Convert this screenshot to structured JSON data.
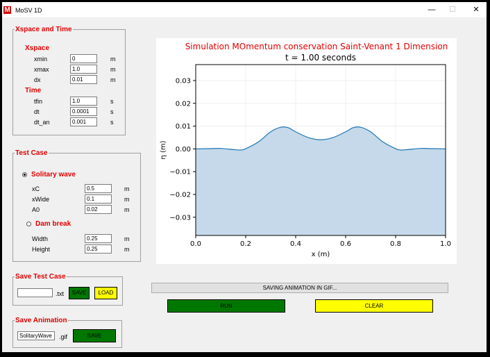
{
  "window": {
    "title": "MoSV 1D",
    "app_icon_letter": "M",
    "minimize_glyph": "—",
    "maximize_glyph": "☐",
    "close_glyph": "✕"
  },
  "xspace_time": {
    "legend": "Xspace and Time",
    "xspace_header": "Xspace",
    "time_header": "Time",
    "fields": [
      {
        "label": "xmin",
        "value": "0",
        "unit": "m"
      },
      {
        "label": "xmax",
        "value": "1.0",
        "unit": "m"
      },
      {
        "label": "dx",
        "value": "0.01",
        "unit": "m"
      },
      {
        "label": "tfin",
        "value": "1.0",
        "unit": "s"
      },
      {
        "label": "dt",
        "value": "0.0001",
        "unit": "s"
      },
      {
        "label": "dt_an",
        "value": "0.001",
        "unit": "s"
      }
    ]
  },
  "test_case": {
    "legend": "Test Case",
    "options": [
      {
        "label": "Solitary wave",
        "selected": true
      },
      {
        "label": "Dam break",
        "selected": false
      }
    ],
    "solitary_fields": [
      {
        "label": "xC",
        "value": "0.5",
        "unit": "m"
      },
      {
        "label": "xWide",
        "value": "0.1",
        "unit": "m"
      },
      {
        "label": "A0",
        "value": "0.02",
        "unit": "m"
      }
    ],
    "dam_fields": [
      {
        "label": "Width",
        "value": "0.25",
        "unit": "m"
      },
      {
        "label": "Height",
        "value": "0.25",
        "unit": "m"
      }
    ]
  },
  "save_test_case": {
    "legend": "Save Test Case",
    "filename": "",
    "extension": ".txt",
    "save_label": "SAVE",
    "load_label": "LOAD"
  },
  "save_animation": {
    "legend": "Save Animation",
    "filename": "SolitaryWave",
    "extension": ".gif",
    "save_label": "SAVE"
  },
  "status_text": "SAVING ANIMATION IN GIF...",
  "run_label": "RUN",
  "clear_label": "CLEAR",
  "colors": {
    "accent_red": "#e00000",
    "run_green": "#007800",
    "clear_yellow": "#ffff00",
    "line_blue": "#1f77b4",
    "fill_blue": "#c5d9ea"
  },
  "chart_data": {
    "type": "area",
    "title": "Simulation MOmentum conservation Saint-Venant 1 Dimension",
    "subtitle": "t = 1.00 seconds",
    "xlabel": "x (m)",
    "ylabel": "η (m)",
    "xlim": [
      0.0,
      1.0
    ],
    "ylim": [
      -0.038,
      0.037
    ],
    "xticks": [
      "0.0",
      "0.2",
      "0.4",
      "0.6",
      "0.8",
      "1.0"
    ],
    "yticks": [
      "0.03",
      "0.02",
      "0.01",
      "0.00",
      "−0.01",
      "−0.02",
      "−0.03"
    ],
    "grid": true,
    "x": [
      0.0,
      0.05,
      0.1,
      0.15,
      0.18,
      0.2,
      0.25,
      0.3,
      0.34,
      0.37,
      0.4,
      0.45,
      0.5,
      0.55,
      0.6,
      0.63,
      0.66,
      0.7,
      0.75,
      0.8,
      0.82,
      0.85,
      0.9,
      0.95,
      1.0
    ],
    "y": [
      0.0,
      0.0001,
      0.0002,
      -0.0003,
      -0.0005,
      0.0001,
      0.003,
      0.0075,
      0.0095,
      0.0093,
      0.0075,
      0.005,
      0.004,
      0.005,
      0.0075,
      0.0093,
      0.0095,
      0.0075,
      0.003,
      0.0001,
      -0.0005,
      -0.0003,
      0.0002,
      0.0001,
      0.0
    ]
  }
}
